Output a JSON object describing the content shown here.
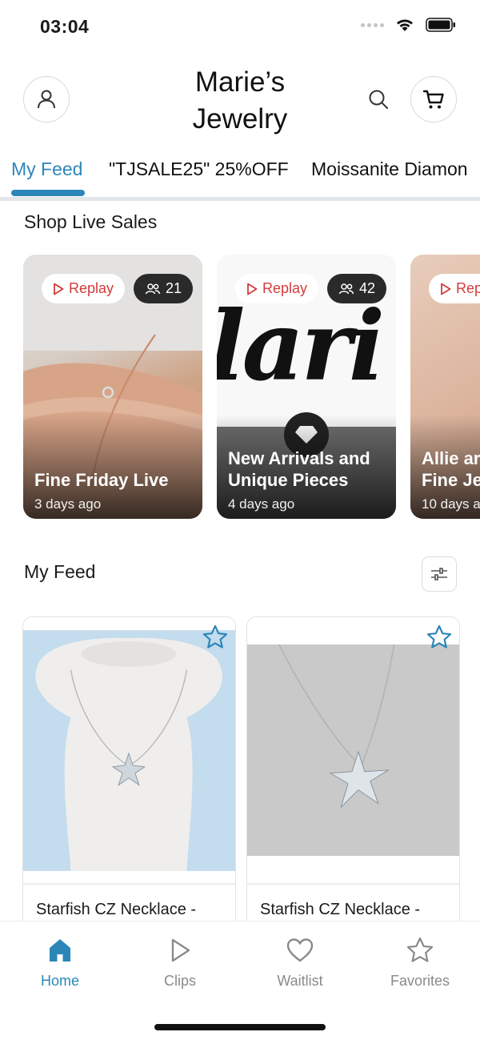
{
  "status_bar": {
    "time": "03:04",
    "icons": [
      "signal-dots-icon",
      "wifi-icon",
      "battery-icon"
    ]
  },
  "header": {
    "title": "Marie’s Jewelry",
    "title_line1": "Marie’s",
    "title_line2": "Jewelry",
    "icons": [
      "profile-icon",
      "search-icon",
      "cart-icon"
    ]
  },
  "tabs": [
    {
      "label": "My Feed",
      "active": true
    },
    {
      "label": "\"TJSALE25\" 25%OFF",
      "active": false
    },
    {
      "label": "Moissanite Diamon",
      "active": false
    }
  ],
  "live_section": {
    "title": "Shop Live Sales",
    "cards": [
      {
        "badge": "Replay",
        "viewers": "21",
        "title": "Fine Friday Live",
        "time": "3 days ago"
      },
      {
        "badge": "Replay",
        "viewers": "42",
        "title": "New Arrivals and Unique Pieces",
        "time": "4 days ago",
        "bg_text": "lari"
      },
      {
        "badge": "Rep",
        "viewers": "",
        "title": "Allie ar Fine Je",
        "time": "10 days a"
      }
    ]
  },
  "feed_section": {
    "title": "My Feed",
    "filter_icon": "sliders-icon",
    "products": [
      {
        "name": "Starfish CZ Necklace -",
        "favorite_icon": "star-outline-icon"
      },
      {
        "name": "Starfish CZ Necklace -",
        "favorite_icon": "star-outline-icon"
      }
    ]
  },
  "bottom_nav": [
    {
      "label": "Home",
      "icon": "home-icon",
      "active": true
    },
    {
      "label": "Clips",
      "icon": "play-icon",
      "active": false
    },
    {
      "label": "Waitlist",
      "icon": "heart-icon",
      "active": false
    },
    {
      "label": "Favorites",
      "icon": "star-icon",
      "active": false
    }
  ],
  "colors": {
    "accent": "#2d86b8",
    "replay_red": "#d23b3b",
    "inactive_gray": "#8a8a8a"
  }
}
